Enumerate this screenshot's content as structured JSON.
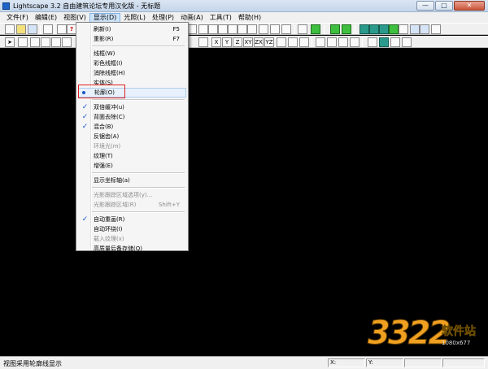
{
  "window": {
    "title": "Lightscape 3.2 自由建筑论坛专用汉化版 - 无标题",
    "minimize_glyph": "—",
    "maximize_glyph": "□",
    "close_glyph": "✕"
  },
  "menubar": {
    "items": [
      "文件(F)",
      "编辑(E)",
      "视图(V)",
      "显示(D)",
      "光照(L)",
      "处理(P)",
      "动画(A)",
      "工具(T)",
      "帮助(H)"
    ],
    "active": "显示(D)"
  },
  "toolbar2": {
    "axis_buttons": [
      "X",
      "Y",
      "Z",
      "XY",
      "ZX",
      "YZ"
    ]
  },
  "display_menu": {
    "items": [
      {
        "label": "刷新(I)",
        "shortcut": "F5",
        "enabled": true,
        "checked": false
      },
      {
        "label": "重影(R)",
        "shortcut": "F7",
        "enabled": true,
        "checked": false
      },
      {
        "separator": true
      },
      {
        "label": "线框(W)",
        "enabled": true,
        "checked": false
      },
      {
        "label": "彩色线框(I)",
        "enabled": true,
        "checked": false
      },
      {
        "label": "消除线框(H)",
        "enabled": true,
        "checked": false
      },
      {
        "label": "实体(S)",
        "enabled": true,
        "checked": false
      },
      {
        "label": "轮廓(O)",
        "enabled": true,
        "selected_radio": true,
        "highlighted": true
      },
      {
        "separator": true
      },
      {
        "label": "双倍缓冲(u)",
        "enabled": true,
        "checked": true
      },
      {
        "label": "背面去除(C)",
        "enabled": true,
        "checked": true
      },
      {
        "label": "混合(B)",
        "enabled": true,
        "checked": true
      },
      {
        "label": "反锯齿(A)",
        "enabled": true,
        "checked": false
      },
      {
        "label": "环境光(m)",
        "enabled": false,
        "checked": false
      },
      {
        "label": "纹理(T)",
        "enabled": true,
        "checked": false
      },
      {
        "label": "增强(E)",
        "enabled": true,
        "checked": false
      },
      {
        "separator": true
      },
      {
        "label": "显示坐标轴(a)",
        "enabled": true,
        "checked": false
      },
      {
        "separator": true
      },
      {
        "label": "光影跟踪区域选项(y)...",
        "enabled": false,
        "checked": false
      },
      {
        "label": "光影跟踪区域(R)",
        "shortcut": "Shift+Y",
        "enabled": false,
        "checked": false
      },
      {
        "separator": true
      },
      {
        "label": "自动重画(R)",
        "enabled": true,
        "checked": true
      },
      {
        "label": "自动环绕(I)",
        "enabled": true,
        "checked": false
      },
      {
        "label": "载入纹理(x)",
        "enabled": false,
        "checked": false
      },
      {
        "label": "高质量后备存储(Q)",
        "enabled": true,
        "checked": false
      }
    ]
  },
  "statusbar": {
    "message": "视图采用轮廓线显示",
    "x_label": "X:",
    "y_label": "Y:"
  },
  "watermark": {
    "digits": "3322",
    "site_name": "软件站",
    "dims": "1080x677"
  },
  "colors": {
    "canvas": "#000000",
    "check": "#1c56c4",
    "callout": "#e02020"
  }
}
